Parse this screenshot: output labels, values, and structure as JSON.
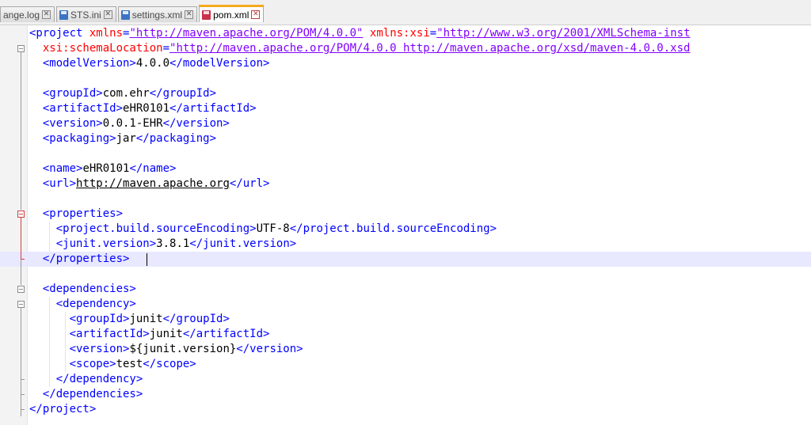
{
  "tabs": [
    {
      "label": "ange.log",
      "icon": "log-file-icon",
      "active": false
    },
    {
      "label": "STS.ini",
      "icon": "save-file-icon",
      "active": false
    },
    {
      "label": "settings.xml",
      "icon": "save-file-icon",
      "active": false
    },
    {
      "label": "pom.xml",
      "icon": "save-file-red-icon",
      "active": true
    }
  ],
  "colors": {
    "tag": "#0000ff",
    "attribute_name": "#ff0000",
    "attribute_value": "#8000ff",
    "text": "#000000",
    "current_line": "#e8e8ff",
    "active_tab_accent": "#f4a91e"
  },
  "editor": {
    "lines": [
      {
        "n": 1,
        "parts": [
          [
            "t",
            "<project "
          ],
          [
            "an",
            "xmlns"
          ],
          [
            "t",
            "="
          ],
          [
            "av",
            "\"http://maven.apache.org/POM/4.0.0\""
          ],
          [
            "t",
            " "
          ],
          [
            "an",
            "xmlns:xsi"
          ],
          [
            "t",
            "="
          ],
          [
            "av",
            "\"http://www.w3.org/2001/XMLSchema-inst"
          ]
        ]
      },
      {
        "n": 2,
        "parts": [
          [
            "t",
            "  "
          ],
          [
            "an",
            "xsi:schemaLocation"
          ],
          [
            "t",
            "="
          ],
          [
            "av",
            "\"http://maven.apache.org/POM/4.0.0 http://maven.apache.org/xsd/maven-4.0.0.xsd"
          ]
        ]
      },
      {
        "n": 3,
        "parts": [
          [
            "t",
            "  <modelVersion>"
          ],
          [
            "tx",
            "4.0.0"
          ],
          [
            "t",
            "</modelVersion>"
          ]
        ]
      },
      {
        "n": 4,
        "parts": []
      },
      {
        "n": 5,
        "parts": [
          [
            "t",
            "  <groupId>"
          ],
          [
            "tx",
            "com.ehr"
          ],
          [
            "t",
            "</groupId>"
          ]
        ]
      },
      {
        "n": 6,
        "parts": [
          [
            "t",
            "  <artifactId>"
          ],
          [
            "tx",
            "eHR0101"
          ],
          [
            "t",
            "</artifactId>"
          ]
        ]
      },
      {
        "n": 7,
        "parts": [
          [
            "t",
            "  <version>"
          ],
          [
            "tx",
            "0.0.1-EHR"
          ],
          [
            "t",
            "</version>"
          ]
        ]
      },
      {
        "n": 8,
        "parts": [
          [
            "t",
            "  <packaging>"
          ],
          [
            "tx",
            "jar"
          ],
          [
            "t",
            "</packaging>"
          ]
        ]
      },
      {
        "n": 9,
        "parts": []
      },
      {
        "n": 10,
        "parts": [
          [
            "t",
            "  <name>"
          ],
          [
            "tx",
            "eHR0101"
          ],
          [
            "t",
            "</name>"
          ]
        ]
      },
      {
        "n": 11,
        "parts": [
          [
            "t",
            "  <url>"
          ],
          [
            "url",
            "http://maven.apache.org"
          ],
          [
            "t",
            "</url>"
          ]
        ]
      },
      {
        "n": 12,
        "parts": []
      },
      {
        "n": 13,
        "parts": [
          [
            "t",
            "  <properties>"
          ]
        ]
      },
      {
        "n": 14,
        "parts": [
          [
            "t",
            "    <project.build.sourceEncoding>"
          ],
          [
            "tx",
            "UTF-8"
          ],
          [
            "t",
            "</project.build.sourceEncoding>"
          ]
        ]
      },
      {
        "n": 15,
        "parts": [
          [
            "t",
            "    <junit.version>"
          ],
          [
            "tx",
            "3.8.1"
          ],
          [
            "t",
            "</junit.version>"
          ]
        ]
      },
      {
        "n": 16,
        "parts": [
          [
            "t",
            "  </properties>"
          ]
        ],
        "current": true
      },
      {
        "n": 17,
        "parts": []
      },
      {
        "n": 18,
        "parts": [
          [
            "t",
            "  <dependencies>"
          ]
        ]
      },
      {
        "n": 19,
        "parts": [
          [
            "t",
            "    <dependency>"
          ]
        ]
      },
      {
        "n": 20,
        "parts": [
          [
            "t",
            "      <groupId>"
          ],
          [
            "tx",
            "junit"
          ],
          [
            "t",
            "</groupId>"
          ]
        ]
      },
      {
        "n": 21,
        "parts": [
          [
            "t",
            "      <artifactId>"
          ],
          [
            "tx",
            "junit"
          ],
          [
            "t",
            "</artifactId>"
          ]
        ]
      },
      {
        "n": 22,
        "parts": [
          [
            "t",
            "      <version>"
          ],
          [
            "tx",
            "${junit.version}"
          ],
          [
            "t",
            "</version>"
          ]
        ]
      },
      {
        "n": 23,
        "parts": [
          [
            "t",
            "      <scope>"
          ],
          [
            "tx",
            "test"
          ],
          [
            "t",
            "</scope>"
          ]
        ]
      },
      {
        "n": 24,
        "parts": [
          [
            "t",
            "    </dependency>"
          ]
        ]
      },
      {
        "n": 25,
        "parts": [
          [
            "t",
            "  </dependencies>"
          ]
        ]
      },
      {
        "n": 26,
        "parts": [
          [
            "t",
            "</project>"
          ]
        ]
      }
    ]
  }
}
